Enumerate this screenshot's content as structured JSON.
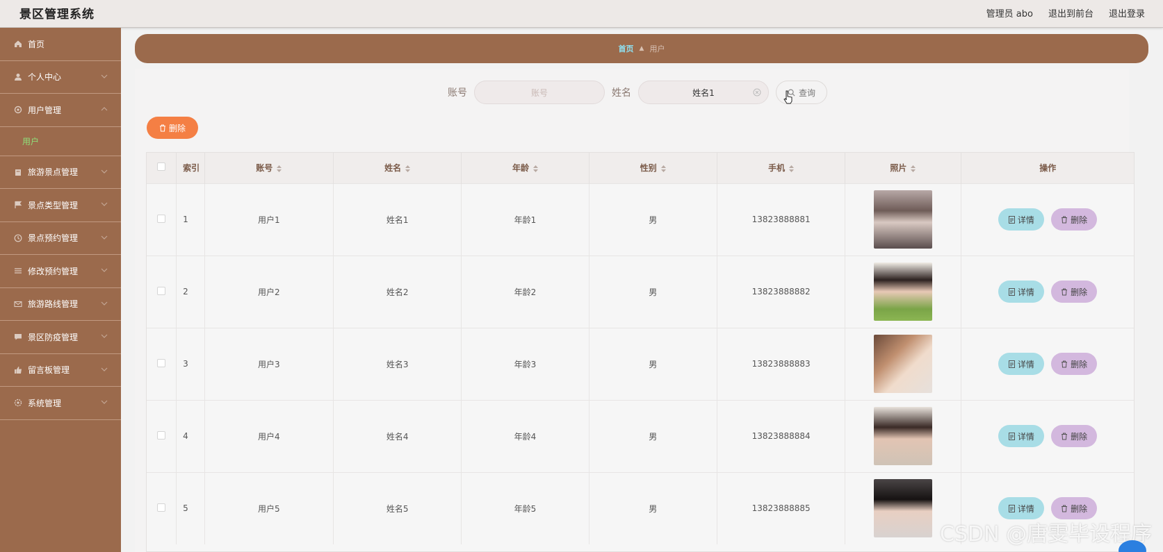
{
  "header": {
    "app_title": "景区管理系统",
    "admin_label": "管理员 abo",
    "back_frontend": "退出到前台",
    "logout": "退出登录"
  },
  "sidebar": {
    "items": [
      {
        "label": "首页",
        "icon": "home-icon"
      },
      {
        "label": "个人中心",
        "icon": "user-icon"
      },
      {
        "label": "用户管理",
        "icon": "settings-icon"
      },
      {
        "label": "用户",
        "icon": "",
        "sub": true
      },
      {
        "label": "旅游景点管理",
        "icon": "building-icon"
      },
      {
        "label": "景点类型管理",
        "icon": "flag-icon"
      },
      {
        "label": "景点预约管理",
        "icon": "clock-icon"
      },
      {
        "label": "修改预约管理",
        "icon": "list-icon"
      },
      {
        "label": "旅游路线管理",
        "icon": "mail-icon"
      },
      {
        "label": "景区防疫管理",
        "icon": "chat-icon"
      },
      {
        "label": "留言板管理",
        "icon": "thumb-icon"
      },
      {
        "label": "系统管理",
        "icon": "settings-icon"
      }
    ]
  },
  "breadcrumb": {
    "home": "首页",
    "current": "用户"
  },
  "search": {
    "account_label": "账号",
    "account_placeholder": "账号",
    "name_label": "姓名",
    "name_value": "姓名1",
    "query_label": "查询"
  },
  "actions": {
    "delete_label": "删除"
  },
  "table": {
    "headers": [
      "索引",
      "账号",
      "姓名",
      "年龄",
      "性别",
      "手机",
      "照片",
      "操作"
    ],
    "rows": [
      {
        "index": "1",
        "account": "用户1",
        "name": "姓名1",
        "age": "年龄1",
        "gender": "男",
        "phone": "13823888881"
      },
      {
        "index": "2",
        "account": "用户2",
        "name": "姓名2",
        "age": "年龄2",
        "gender": "男",
        "phone": "13823888882"
      },
      {
        "index": "3",
        "account": "用户3",
        "name": "姓名3",
        "age": "年龄3",
        "gender": "男",
        "phone": "13823888883"
      },
      {
        "index": "4",
        "account": "用户4",
        "name": "姓名4",
        "age": "年龄4",
        "gender": "男",
        "phone": "13823888884"
      },
      {
        "index": "5",
        "account": "用户5",
        "name": "姓名5",
        "age": "年龄5",
        "gender": "男",
        "phone": "13823888885"
      }
    ],
    "detail_label": "详情",
    "row_delete_label": "删除"
  },
  "watermark": "CSDN @唐雯毕设程序",
  "colors": {
    "sidebar": "#9b6a4c",
    "accent_orange": "#f47f44",
    "detail": "#a8dde6",
    "delete": "#d3b8de"
  }
}
